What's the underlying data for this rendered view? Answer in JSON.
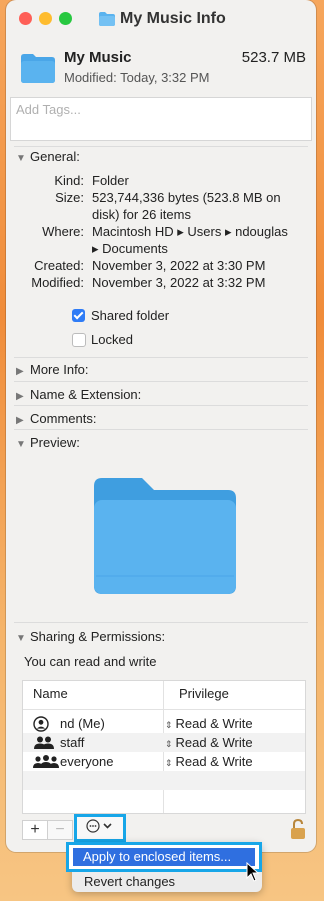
{
  "window": {
    "title": "My Music Info"
  },
  "header": {
    "name": "My Music",
    "size": "523.7 MB",
    "modified": "Modified: Today, 3:32 PM"
  },
  "tags": {
    "placeholder": "Add Tags..."
  },
  "general": {
    "heading": "General:",
    "rows": [
      {
        "key": "Kind:",
        "value": "Folder"
      },
      {
        "key": "Size:",
        "value": "523,744,336 bytes (523.8 MB on"
      },
      {
        "key": "",
        "value": "disk) for 26 items"
      },
      {
        "key": "Where:",
        "value": "Macintosh HD ▸ Users ▸ ndouglas"
      },
      {
        "key": "",
        "value": "▸ Documents"
      },
      {
        "key": "Created:",
        "value": "November 3, 2022 at 3:30 PM"
      },
      {
        "key": "Modified:",
        "value": "November 3, 2022 at 3:32 PM"
      }
    ],
    "shared_folder": {
      "label": "Shared folder",
      "checked": true
    },
    "locked": {
      "label": "Locked",
      "checked": false
    }
  },
  "sections": {
    "more_info": "More Info:",
    "name_extension": "Name & Extension:",
    "comments": "Comments:",
    "preview": "Preview:",
    "sharing": "Sharing & Permissions:"
  },
  "permissions": {
    "note": "You can read and write",
    "headers": {
      "name": "Name",
      "privilege": "Privilege"
    },
    "rows": [
      {
        "icon": "user-circle-icon",
        "name": "nd           (Me)",
        "privilege": "Read & Write"
      },
      {
        "icon": "group-icon",
        "name": "staff",
        "privilege": "Read & Write"
      },
      {
        "icon": "everyone-icon",
        "name": "everyone",
        "privilege": "Read & Write"
      }
    ]
  },
  "toolbar": {
    "add": "+",
    "remove": "−"
  },
  "menu": {
    "items": [
      "Apply to enclosed items...",
      "Revert changes"
    ]
  },
  "colors": {
    "accent": "#2f6fe0",
    "highlight_outline": "#17a6e8",
    "folder": "#5ab3ef"
  }
}
